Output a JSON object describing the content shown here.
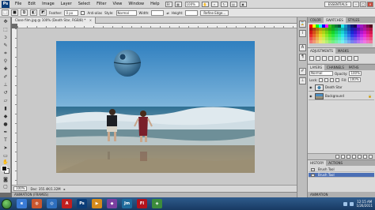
{
  "menubar": {
    "logo": "Ps",
    "items": [
      "File",
      "Edit",
      "Image",
      "Layer",
      "Select",
      "Filter",
      "View",
      "Window",
      "Help"
    ],
    "zoom": "100%",
    "workspace": "ESSENTIALS",
    "window_buttons": [
      "–",
      "□",
      "×"
    ]
  },
  "options": {
    "feather_label": "Feather:",
    "feather_value": "0 px",
    "antialias_label": "Anti-alias",
    "style_label": "Style:",
    "style_value": "Normal",
    "width_label": "Width:",
    "height_label": "Height:",
    "refine_button": "Refine Edge..."
  },
  "document": {
    "tab_title": "Close film.jpg @ 100% (Death Star, RGB/8) *",
    "zoom_status": "100%",
    "doc_size": "Doc: 355.4K/1.32M",
    "animation_tab": "ANIMATION (FRAMES)"
  },
  "panels": {
    "color_tabs": [
      "COLOR",
      "SWATCHES",
      "STYLES"
    ],
    "adjust_tabs": [
      "ADJUSTMENTS",
      "MASKS"
    ],
    "layers_tabs": [
      "LAYERS",
      "CHANNELS",
      "PATHS"
    ],
    "blend_mode": "Normal",
    "opacity_label": "Opacity:",
    "opacity_value": "100%",
    "lock_label": "Lock:",
    "fill_label": "Fill:",
    "fill_value": "100%",
    "layers": [
      {
        "name": "Death Star",
        "selected": true
      },
      {
        "name": "Background",
        "selected": false
      }
    ],
    "history_tabs": [
      "HISTORY",
      "ACTIONS"
    ],
    "history": [
      {
        "name": "Brush Tool",
        "selected": false
      },
      {
        "name": "Brush Tool",
        "selected": true
      }
    ],
    "bottom_tab": "ANIMATION"
  },
  "taskbar": {
    "apps": [
      {
        "label": "e",
        "color": "#3a7bd5"
      },
      {
        "label": "◍",
        "color": "#c9572f"
      },
      {
        "label": "◎",
        "color": "#2e6fbe"
      },
      {
        "label": "A",
        "color": "#c21f1f"
      },
      {
        "label": "Ps",
        "color": "#0b3d78"
      },
      {
        "label": "▶",
        "color": "#d48a1c"
      },
      {
        "label": "◆",
        "color": "#7a3fa0"
      },
      {
        "label": "Jm",
        "color": "#1f6b9c"
      },
      {
        "label": "Fl",
        "color": "#b3121c"
      },
      {
        "label": "◈",
        "color": "#3c8c3c"
      }
    ],
    "time": "12:15 AM",
    "date": "1/26/2011"
  }
}
